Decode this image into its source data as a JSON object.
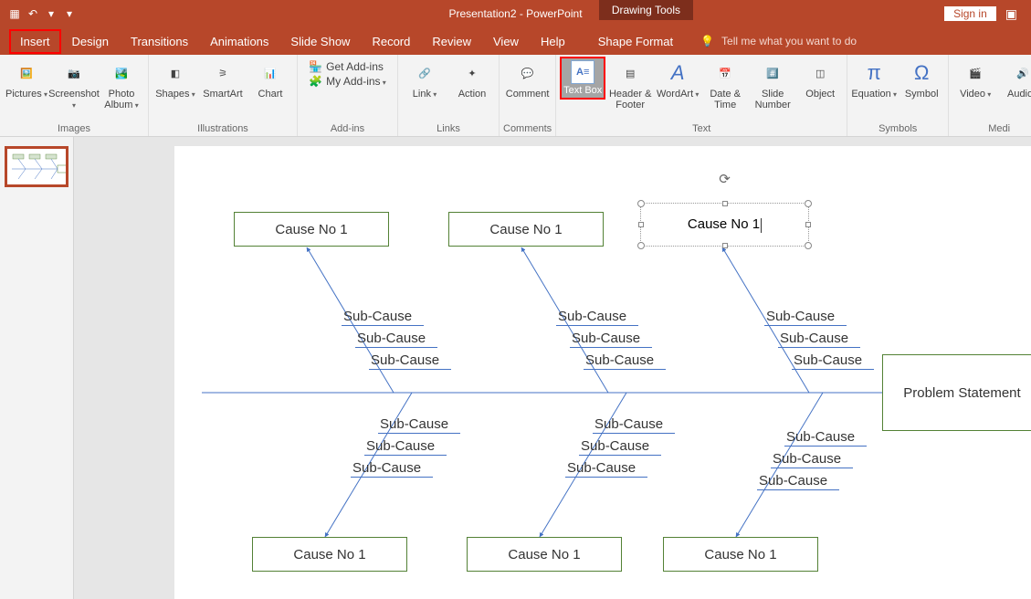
{
  "title_bar": {
    "doc_title": "Presentation2 - PowerPoint",
    "context_tab": "Drawing Tools",
    "sign_in": "Sign in"
  },
  "tabs": {
    "insert": "Insert",
    "design": "Design",
    "transitions": "Transitions",
    "animations": "Animations",
    "slide_show": "Slide Show",
    "record": "Record",
    "review": "Review",
    "view": "View",
    "help": "Help",
    "shape_format": "Shape Format",
    "tell_me": "Tell me what you want to do"
  },
  "ribbon": {
    "images": {
      "label": "Images",
      "pictures": "Pictures",
      "screenshot": "Screenshot",
      "photo_album": "Photo Album"
    },
    "illustrations": {
      "label": "Illustrations",
      "shapes": "Shapes",
      "smartart": "SmartArt",
      "chart": "Chart"
    },
    "addins": {
      "label": "Add-ins",
      "get": "Get Add-ins",
      "my": "My Add-ins"
    },
    "links": {
      "label": "Links",
      "link": "Link",
      "action": "Action"
    },
    "comments": {
      "label": "Comments",
      "comment": "Comment"
    },
    "text": {
      "label": "Text",
      "text_box": "Text Box",
      "header_footer": "Header & Footer",
      "wordart": "WordArt",
      "date_time": "Date & Time",
      "slide_number": "Slide Number",
      "object": "Object"
    },
    "symbols": {
      "label": "Symbols",
      "equation": "Equation",
      "symbol": "Symbol"
    },
    "media": {
      "label": "Medi",
      "video": "Video",
      "audio": "Audio"
    }
  },
  "diagram": {
    "cause_label": "Cause No 1",
    "selected_cause": "Cause No 1",
    "subcause": "Sub-Cause",
    "problem": "Problem Statement"
  }
}
